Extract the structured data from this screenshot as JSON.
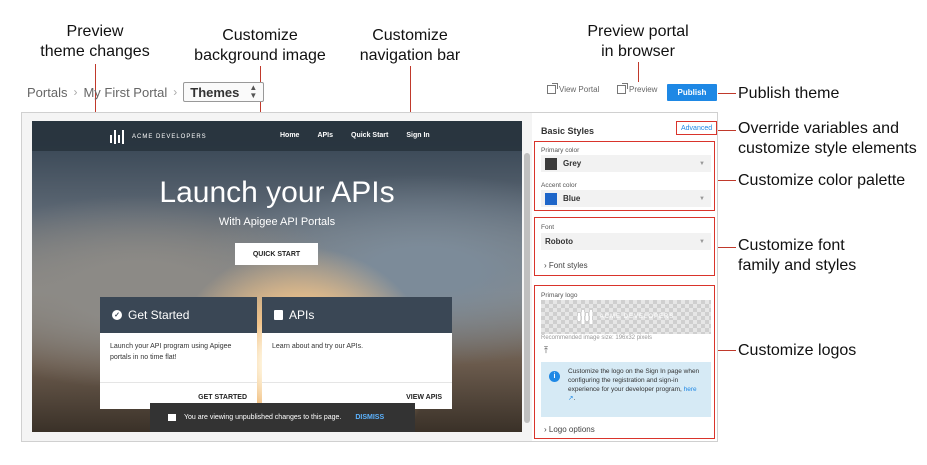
{
  "annotations": {
    "preview_theme": [
      "Preview",
      "theme changes"
    ],
    "bg_image": [
      "Customize",
      "background image"
    ],
    "nav_bar": [
      "Customize",
      "navigation bar"
    ],
    "preview_portal": [
      "Preview portal",
      "in browser"
    ],
    "publish_theme": "Publish theme",
    "override": [
      "Override variables and",
      "customize style elements"
    ],
    "color_palette": "Customize color palette",
    "font": [
      "Customize font",
      "family and styles"
    ],
    "logos": "Customize logos",
    "line_color": "#c0392b"
  },
  "breadcrumb": {
    "portals": "Portals",
    "sep": "›",
    "portal_name": "My First Portal",
    "themes": "Themes"
  },
  "toolbar": {
    "view_portal": "View Portal",
    "preview": "Preview",
    "publish": "Publish",
    "accent": "#1e88e5"
  },
  "portal_preview": {
    "logo_text": "ACME DEVELOPERS",
    "nav": [
      "Home",
      "APIs",
      "Quick Start",
      "Sign In"
    ],
    "hero_title": "Launch your APIs",
    "hero_subtitle": "With Apigee API Portals",
    "hero_button": "QUICK START",
    "cards": [
      {
        "title": "Get Started",
        "body": "Launch your API program using Apigee portals in no time flat!",
        "action": "GET STARTED"
      },
      {
        "title": "APIs",
        "body": "Learn about and try our APIs.",
        "action": "VIEW APIS"
      }
    ],
    "toast": "You are viewing unpublished changes to this page.",
    "toast_action": "DISMISS"
  },
  "styles_panel": {
    "title": "Basic Styles",
    "advanced": "Advanced",
    "primary_color_label": "Primary color",
    "primary_color_value": "Grey",
    "primary_color_hex": "#3b3b3b",
    "accent_color_label": "Accent color",
    "accent_color_value": "Blue",
    "accent_color_hex": "#1e66c9",
    "font_label": "Font",
    "font_value": "Roboto",
    "font_styles": "Font styles",
    "logo_label": "Primary logo",
    "logo_hint": "Recommended image size: 196x32 pixels",
    "info_text": "Customize the logo on the Sign In page when configuring the registration and sign-in experience for your developer program,",
    "info_link": "here",
    "logo_options": "Logo options"
  }
}
